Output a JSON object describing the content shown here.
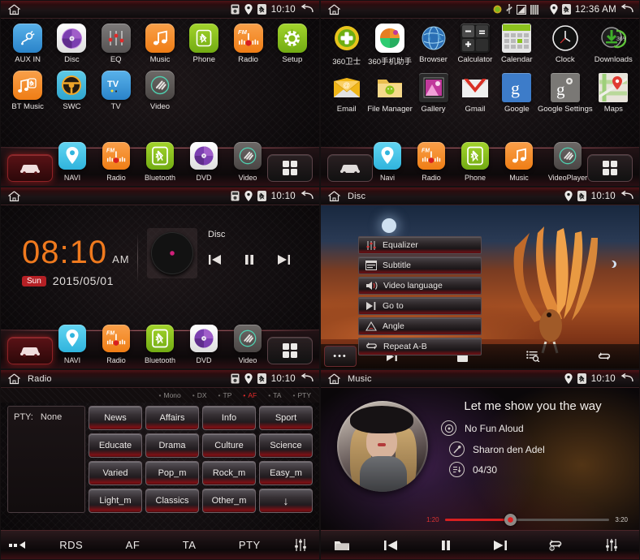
{
  "panels": {
    "home": {
      "statusbar": {
        "title": "",
        "time": "10:10",
        "icons": [
          "sim-card-icon",
          "location-pin-icon",
          "bluetooth-icon"
        ],
        "home_icon": "home-icon",
        "back_icon": "back-icon"
      },
      "apps_row1": [
        {
          "label": "AUX IN",
          "icon": "aux-plug-icon",
          "color": "#3c9bdd"
        },
        {
          "label": "Disc",
          "icon": "disc-icon",
          "color": "#f4f4f4"
        },
        {
          "label": "EQ",
          "icon": "equalizer-icon",
          "color": "#6d6a6a"
        },
        {
          "label": "Music",
          "icon": "music-note-icon",
          "color": "#f5881f"
        },
        {
          "label": "Phone",
          "icon": "bluetooth-phone-icon",
          "color": "#8cc21e"
        },
        {
          "label": "Radio",
          "icon": "fm-radio-icon",
          "color": "#f5881f"
        },
        {
          "label": "Setup",
          "icon": "gear-icon",
          "color": "#8cc21e"
        }
      ],
      "apps_row2": [
        {
          "label": "BT Music",
          "icon": "bt-music-icon",
          "color": "#f5881f"
        },
        {
          "label": "SWC",
          "icon": "steering-wheel-icon",
          "color": "#3fb6d8"
        },
        {
          "label": "TV",
          "icon": "tv-icon",
          "color": "#3c9bdd"
        },
        {
          "label": "Video",
          "icon": "video-icon",
          "color": "#57524f"
        }
      ],
      "dock": [
        {
          "label": "NAVI",
          "icon": "location-pin-icon",
          "color": "#3fc0e8"
        },
        {
          "label": "Radio",
          "icon": "fm-radio-icon",
          "color": "#f5881f"
        },
        {
          "label": "Bluetooth",
          "icon": "bluetooth-icon",
          "color": "#8cc21e"
        },
        {
          "label": "DVD",
          "icon": "disc-icon",
          "color": "#f4f4f4"
        },
        {
          "label": "Video",
          "icon": "video-icon",
          "color": "#57524f"
        }
      ],
      "dock_left_icon": "car-icon",
      "dock_right_icon": "grid-apps-icon"
    },
    "drawer": {
      "statusbar": {
        "title": "",
        "time": "12:36 AM",
        "icons": [
          "update-icon",
          "usb-icon",
          "screenshot-icon",
          "sdcard-icon",
          "location-pin-icon",
          "bluetooth-icon"
        ]
      },
      "apps_row1": [
        {
          "label": "360卫士",
          "icon": "shield-360-icon"
        },
        {
          "label": "360手机助手",
          "icon": "360-assistant-icon"
        },
        {
          "label": "Browser",
          "icon": "globe-icon"
        },
        {
          "label": "Calculator",
          "icon": "calculator-icon"
        },
        {
          "label": "Calendar",
          "icon": "calendar-icon"
        },
        {
          "label": "Clock",
          "icon": "clock-icon"
        },
        {
          "label": "Downloads",
          "icon": "download-icon",
          "badge": "36%"
        }
      ],
      "apps_row2": [
        {
          "label": "Email",
          "icon": "email-icon"
        },
        {
          "label": "File Manager",
          "icon": "folder-icon"
        },
        {
          "label": "Gallery",
          "icon": "gallery-icon"
        },
        {
          "label": "Gmail",
          "icon": "gmail-icon"
        },
        {
          "label": "Google",
          "icon": "google-g-icon"
        },
        {
          "label": "Google Settings",
          "icon": "google-settings-icon"
        },
        {
          "label": "Maps",
          "icon": "maps-icon"
        }
      ],
      "dock": [
        {
          "label": "Navi",
          "icon": "location-pin-icon",
          "color": "#3fc0e8"
        },
        {
          "label": "Radio",
          "icon": "fm-radio-icon",
          "color": "#f5881f"
        },
        {
          "label": "Phone",
          "icon": "bluetooth-phone-icon",
          "color": "#8cc21e"
        },
        {
          "label": "Music",
          "icon": "music-note-icon",
          "color": "#f5881f"
        },
        {
          "label": "VideoPlayer",
          "icon": "video-icon",
          "color": "#57524f"
        }
      ]
    },
    "clock": {
      "statusbar": {
        "title": "",
        "time": "10:10"
      },
      "time": "08:10",
      "ampm": "AM",
      "day": "Sun",
      "date": "2015/05/01",
      "source": "Disc",
      "controls": [
        "prev-track-icon",
        "pause-icon",
        "next-track-icon"
      ]
    },
    "disc": {
      "statusbar": {
        "title": "Disc",
        "time": "10:10"
      },
      "menu": [
        {
          "label": "Equalizer",
          "icon": "equalizer-icon"
        },
        {
          "label": "Subtitle",
          "icon": "subtitle-icon"
        },
        {
          "label": "Video language",
          "icon": "audio-language-icon"
        },
        {
          "label": "Go to",
          "icon": "goto-icon"
        },
        {
          "label": "Angle",
          "icon": "angle-icon"
        },
        {
          "label": "Repeat A-B",
          "icon": "repeat-ab-icon"
        }
      ],
      "toolbar": [
        "more-dots-icon",
        "next-track-icon",
        "stop-icon",
        "playlist-search-icon",
        "repeat-icon"
      ]
    },
    "radio": {
      "statusbar": {
        "title": "Radio",
        "time": "10:10"
      },
      "indicators": [
        {
          "label": "Mono",
          "active": false
        },
        {
          "label": "DX",
          "active": false
        },
        {
          "label": "TP",
          "active": false
        },
        {
          "label": "AF",
          "active": true
        },
        {
          "label": "TA",
          "active": false
        },
        {
          "label": "PTY",
          "active": false
        }
      ],
      "pty_label": "PTY:",
      "pty_value": "None",
      "categories": [
        "News",
        "Affairs",
        "Info",
        "Sport",
        "Educate",
        "Drama",
        "Culture",
        "Science",
        "Varied",
        "Pop_m",
        "Rock_m",
        "Easy_m",
        "Light_m",
        "Classics",
        "Other_m",
        "↓"
      ],
      "tabs": [
        "RDS",
        "AF",
        "TA",
        "PTY"
      ],
      "left_icon": "back-arrow-icon",
      "right_icon": "equalizer-icon"
    },
    "music": {
      "statusbar": {
        "title": "Music",
        "time": "10:10"
      },
      "track_title": "Let me show you the way",
      "album": "No Fun Aloud",
      "artist": "Sharon den Adel",
      "track_index": "04/30",
      "elapsed": "1:20",
      "duration": "3:20",
      "progress_percent": 40,
      "toolbar": [
        "folder-icon",
        "prev-track-icon",
        "pause-icon",
        "next-track-icon",
        "repeat-one-icon",
        "equalizer-icon"
      ]
    }
  },
  "colors": {
    "accent_red": "#b52025",
    "accent_orange": "#f07a1e",
    "status_active": "#e02a2a",
    "text_primary": "#ece9e7"
  }
}
